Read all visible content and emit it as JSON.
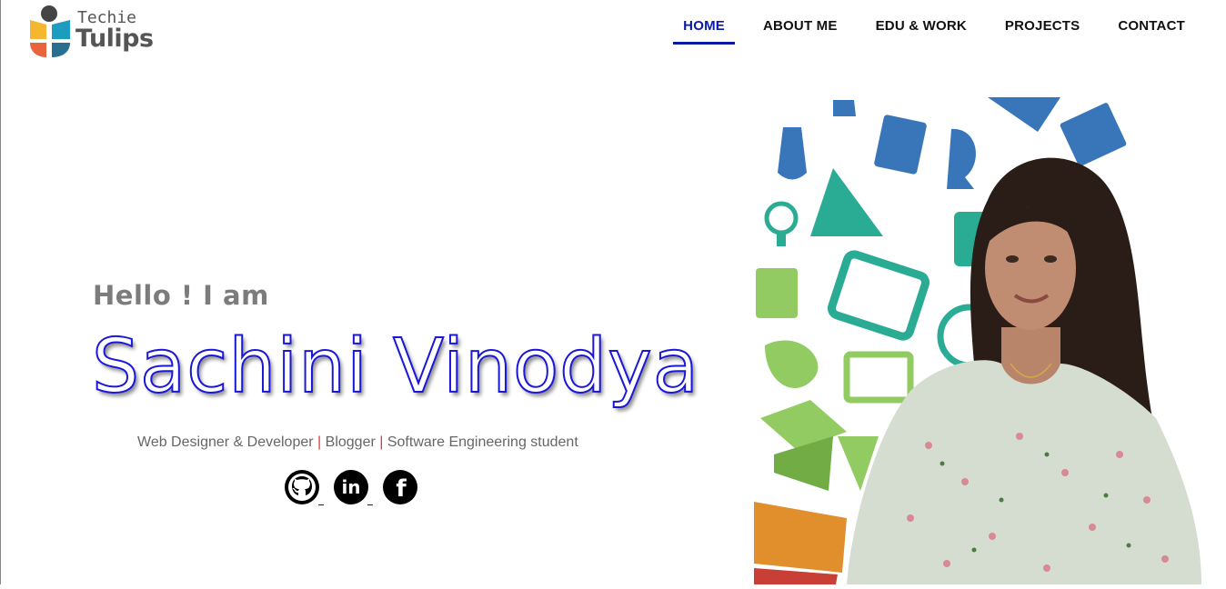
{
  "brand": {
    "line1": "Techie",
    "line2": "Tulips"
  },
  "nav": {
    "items": [
      {
        "label": "HOME",
        "active": true
      },
      {
        "label": "ABOUT ME",
        "active": false
      },
      {
        "label": "EDU & WORK",
        "active": false
      },
      {
        "label": "PROJECTS",
        "active": false
      },
      {
        "label": "CONTACT",
        "active": false
      }
    ]
  },
  "hero": {
    "greeting": "Hello ! I am",
    "name": "Sachini Vinodya",
    "roles": [
      "Web Designer & Developer",
      "Blogger",
      "Software Engineering student"
    ],
    "separator": "|"
  },
  "social": [
    {
      "icon": "github-icon"
    },
    {
      "icon": "linkedin-icon",
      "text": "in"
    },
    {
      "icon": "facebook-icon",
      "text": "f"
    }
  ],
  "colors": {
    "accent": "#0a1aa8",
    "name_stroke": "#1a17d8",
    "separator": "#e03a3a"
  }
}
